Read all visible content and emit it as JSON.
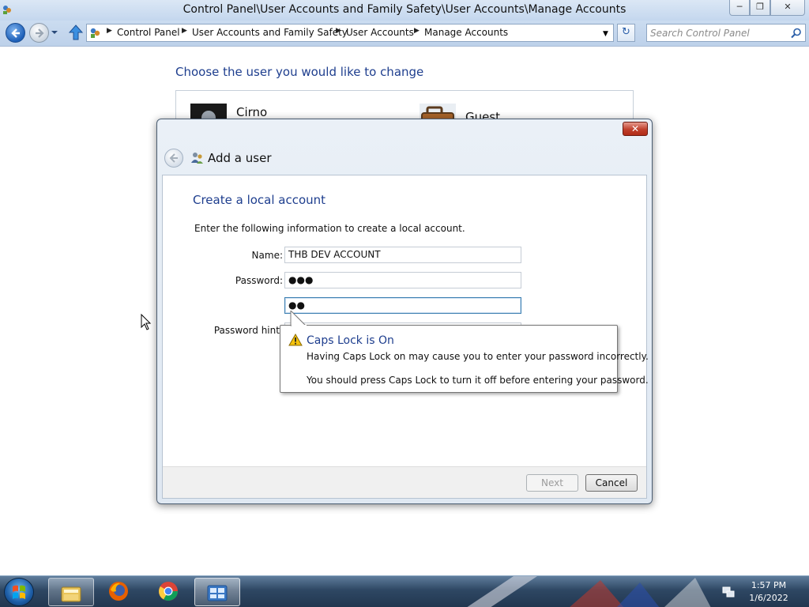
{
  "window": {
    "title": "Control Panel\\User Accounts and Family Safety\\User Accounts\\Manage Accounts"
  },
  "address_bar": {
    "breadcrumbs": [
      "Control Panel",
      "User Accounts and Family Safety",
      "User Accounts",
      "Manage Accounts"
    ]
  },
  "search": {
    "placeholder": "Search Control Panel"
  },
  "page": {
    "heading": "Choose the user you would like to change",
    "users": [
      {
        "name": "Cirno"
      },
      {
        "name": "Guest"
      }
    ]
  },
  "dialog": {
    "title": "Add a user",
    "section_title": "Create a local account",
    "instructions": "Enter the following information to create a local account.",
    "fields": {
      "name": {
        "label": "Name:",
        "value": "THB DEV ACCOUNT"
      },
      "password": {
        "label": "Password:",
        "value": "●●●"
      },
      "confirm": {
        "value": "●●"
      },
      "hint": {
        "label": "Password hint:"
      }
    },
    "buttons": {
      "next": "Next",
      "cancel": "Cancel"
    }
  },
  "balloon": {
    "title": "Caps Lock is On",
    "line1": "Having Caps Lock on may cause you to enter your password incorrectly.",
    "line2": "You should press Caps Lock to turn it off before entering your password."
  },
  "taskbar": {
    "pinned_icons": [
      "windows-explorer-icon",
      "firefox-icon",
      "chrome-icon",
      "control-panel-icon"
    ],
    "time": "1:57 PM",
    "date": "1/6/2022"
  },
  "colors": {
    "link_blue": "#1e3e8e",
    "close_red": "#c0402c",
    "taskbar": "#2e4763"
  }
}
